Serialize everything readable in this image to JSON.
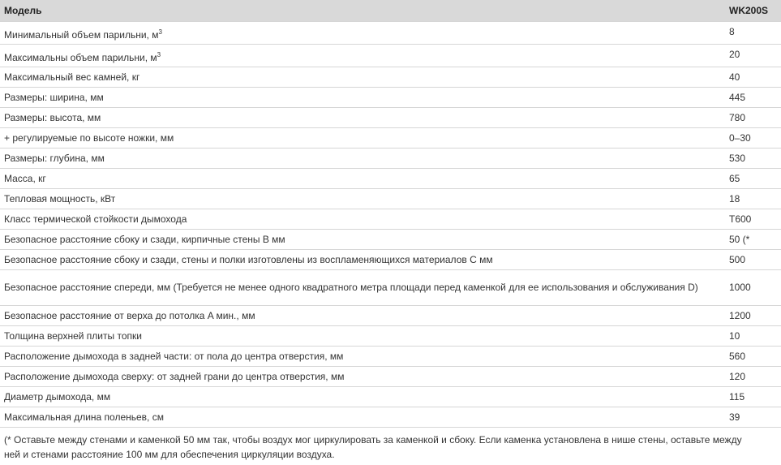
{
  "header": {
    "param_label": "Модель",
    "model": "WK200S"
  },
  "rows": [
    {
      "label": "Минимальный объем парильни, м",
      "sup": "3",
      "value": "8"
    },
    {
      "label": "Максимальны объем парильни, м",
      "sup": "3",
      "value": "20"
    },
    {
      "label": "Максимальный вес камней, кг",
      "value": "40"
    },
    {
      "label": "Размеры: ширина, мм",
      "value": "445"
    },
    {
      "label": "Размеры: высота, мм",
      "value": "780"
    },
    {
      "label": "+ регулируемые по высоте ножки, мм",
      "value": "0–30"
    },
    {
      "label": "Размеры: глубина, мм",
      "value": "530"
    },
    {
      "label": "Масса, кг",
      "value": "65"
    },
    {
      "label": "Тепловая мощность, кВт",
      "value": "18"
    },
    {
      "label": "Класс термической стойкости дымохода",
      "value": "T600"
    },
    {
      "label": "Безопасное расстояние сбоку и сзади, кирпичные стены B мм",
      "value": "50 (*"
    },
    {
      "label": "Безопасное расстояние сбоку и сзади, стены и полки изготовлены из воспламеняющихся материалов C мм",
      "value": "500"
    },
    {
      "label": "Безопасное расстояние спереди, мм (Требуется не менее одного квадратного метра площади перед каменкой для ее использования и обслуживания D)",
      "value": "1000"
    },
    {
      "label": "Безопасное расстояние от верха до потолка A мин., мм",
      "value": "1200"
    },
    {
      "label": "Толщина верхней плиты топки",
      "value": "10"
    },
    {
      "label": "Расположение дымохода в задней части: от пола до центра отверстия, мм",
      "value": "560"
    },
    {
      "label": "Расположение дымохода сверху: от задней грани до центра отверстия, мм",
      "value": "120"
    },
    {
      "label": "Диаметр дымохода, мм",
      "value": "115"
    },
    {
      "label": "Максимальная длина поленьев, см",
      "value": "39"
    }
  ],
  "footnote": "(* Оставьте между стенами и каменкой 50 мм так, чтобы воздух мог циркулировать за каменкой и сбоку. Если каменка установлена в нише стены, оставьте между ней и стенами расстояние 100 мм для обеспечения циркуляции воздуха."
}
